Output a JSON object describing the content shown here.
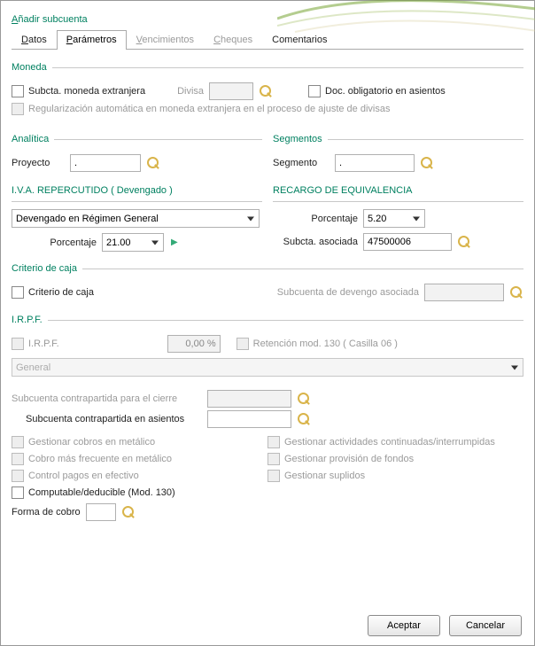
{
  "window": {
    "title_pre": "A",
    "title_rest": "ñadir subcuenta"
  },
  "tabs": {
    "datos_u": "D",
    "datos_rest": "atos",
    "parametros_u": "P",
    "parametros_rest": "arámetros",
    "venc_u": "V",
    "venc_rest": "encimientos",
    "cheques_u": "C",
    "cheques_rest": "heques",
    "coment_u": "C",
    "coment_rest": "omentarios",
    "active": "Parámetros"
  },
  "moneda": {
    "legend": "Moneda",
    "subcta_ext": "Subcta. moneda extranjera",
    "divisa_label": "Divisa",
    "divisa_value": "",
    "doc_oblig": "Doc. obligatorio en asientos",
    "regularizacion": "Regularización automática en moneda extranjera en el proceso de ajuste de divisas"
  },
  "analitica": {
    "legend": "Analítica",
    "proyecto_label": "Proyecto",
    "proyecto_value": "."
  },
  "segmentos": {
    "legend": "Segmentos",
    "segmento_label": "Segmento",
    "segmento_value": "."
  },
  "iva": {
    "legend": "I.V.A. REPERCUTIDO ( Devengado )",
    "regimen_selected": "Devengado en Régimen General",
    "porcentaje_label": "Porcentaje",
    "porcentaje_value": "21.00"
  },
  "recargo": {
    "legend": "RECARGO DE EQUIVALENCIA",
    "porcentaje_label": "Porcentaje",
    "porcentaje_value": "5.20",
    "subcta_label": "Subcta. asociada",
    "subcta_value": "47500006"
  },
  "caja": {
    "legend": "Criterio de caja",
    "criterio": "Criterio de caja",
    "sub_devengo": "Subcuenta de devengo asociada",
    "sub_devengo_value": ""
  },
  "irpf": {
    "legend": "I.R.P.F.",
    "irpf_chk": "I.R.P.F.",
    "pct_value": "0,00 %",
    "retencion": "Retención mod. 130 ( Casilla 06 )",
    "general_selected": "General"
  },
  "misc": {
    "sub_cierre": "Subcuenta contrapartida para el cierre",
    "sub_cierre_value": "",
    "sub_asientos": "Subcuenta contrapartida en asientos",
    "sub_asientos_value": "",
    "cobros_metalico": "Gestionar cobros en metálico",
    "cobro_frecuente": "Cobro más frecuente en metálico",
    "control_pagos": "Control pagos en efectivo",
    "computable": "Computable/deducible (Mod. 130)",
    "actividades": "Gestionar actividades continuadas/interrumpidas",
    "provision": "Gestionar provisión de fondos",
    "suplidos": "Gestionar suplidos",
    "forma_cobro": "Forma de cobro",
    "forma_cobro_value": ""
  },
  "buttons": {
    "aceptar": "Aceptar",
    "cancelar": "Cancelar"
  }
}
